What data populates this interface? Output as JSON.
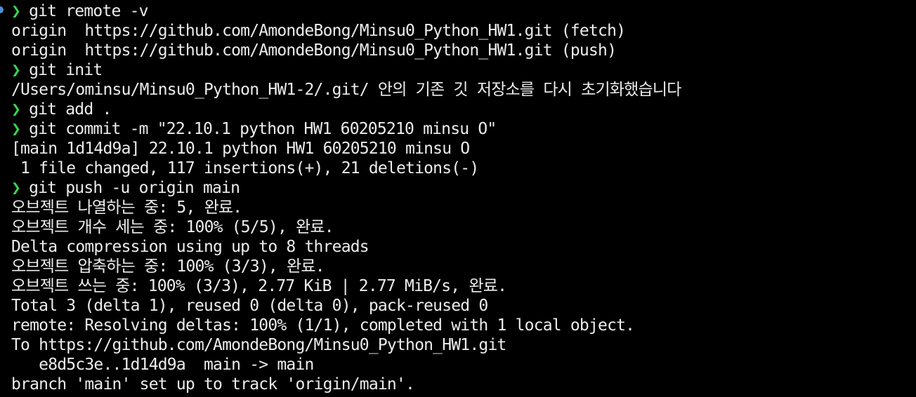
{
  "terminal": {
    "prompt_symbol": "❯",
    "colors": {
      "background": "#000000",
      "text": "#ececec",
      "prompt": "#39d353",
      "status_dot": "#4f8fd6"
    },
    "lines": [
      {
        "type": "command",
        "text": "git remote -v"
      },
      {
        "type": "output",
        "text": "origin  https://github.com/AmondeBong/Minsu0_Python_HW1.git (fetch)"
      },
      {
        "type": "output",
        "text": "origin  https://github.com/AmondeBong/Minsu0_Python_HW1.git (push)"
      },
      {
        "type": "command",
        "text": "git init"
      },
      {
        "type": "output",
        "text": "/Users/ominsu/Minsu0_Python_HW1-2/.git/ 안의 기존 깃 저장소를 다시 초기화했습니다"
      },
      {
        "type": "command",
        "text": "git add ."
      },
      {
        "type": "command",
        "text": "git commit -m \"22.10.1 python HW1 60205210 minsu O\""
      },
      {
        "type": "output",
        "text": "[main 1d14d9a] 22.10.1 python HW1 60205210 minsu O"
      },
      {
        "type": "output",
        "text": " 1 file changed, 117 insertions(+), 21 deletions(-)"
      },
      {
        "type": "command",
        "text": "git push -u origin main"
      },
      {
        "type": "output",
        "text": "오브젝트 나열하는 중: 5, 완료."
      },
      {
        "type": "output",
        "text": "오브젝트 개수 세는 중: 100% (5/5), 완료."
      },
      {
        "type": "output",
        "text": "Delta compression using up to 8 threads"
      },
      {
        "type": "output",
        "text": "오브젝트 압축하는 중: 100% (3/3), 완료."
      },
      {
        "type": "output",
        "text": "오브젝트 쓰는 중: 100% (3/3), 2.77 KiB | 2.77 MiB/s, 완료."
      },
      {
        "type": "output",
        "text": "Total 3 (delta 1), reused 0 (delta 0), pack-reused 0"
      },
      {
        "type": "output",
        "text": "remote: Resolving deltas: 100% (1/1), completed with 1 local object."
      },
      {
        "type": "output",
        "text": "To https://github.com/AmondeBong/Minsu0_Python_HW1.git"
      },
      {
        "type": "output",
        "text": "   e8d5c3e..1d14d9a  main -> main"
      },
      {
        "type": "output",
        "text": "branch 'main' set up to track 'origin/main'."
      }
    ]
  }
}
